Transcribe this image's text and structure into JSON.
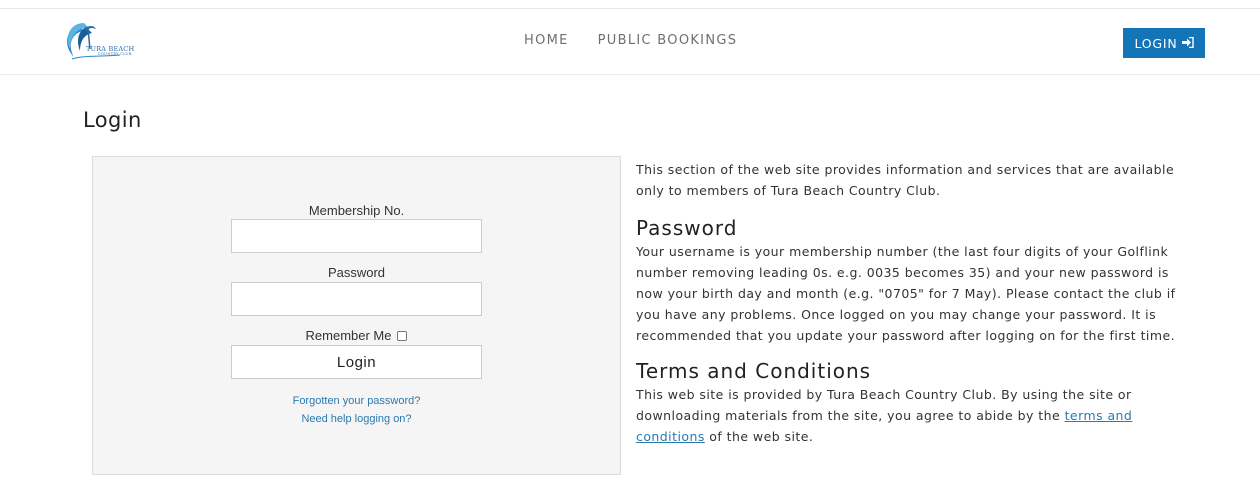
{
  "brand": {
    "logo_text": "TURA BEACH",
    "logo_subtext": "COUNTRY CLUB",
    "colors": {
      "primary": "#1474b8",
      "link": "#2a7ab0",
      "panel_bg": "#f5f5f5"
    }
  },
  "nav": {
    "items": [
      {
        "label": "HOME"
      },
      {
        "label": "PUBLIC BOOKINGS"
      }
    ],
    "login_label": "LOGIN",
    "login_icon": "sign-in-icon"
  },
  "page": {
    "title": "Login"
  },
  "form": {
    "membership_label": "Membership No.",
    "membership_value": "",
    "password_label": "Password",
    "password_value": "",
    "remember_label": "Remember Me",
    "remember_checked": false,
    "submit_label": "Login",
    "forgot_link": "Forgotten your password?",
    "help_link": "Need help logging on?"
  },
  "info": {
    "intro": "This section of the web site provides information and services that are available only to members of Tura Beach Country Club.",
    "password_heading": "Password",
    "password_text": "Your username is your membership number (the last four digits of your Golflink number removing leading 0s. e.g. 0035 becomes 35) and your new password is now your birth day and month (e.g. \"0705\" for 7 May). Please contact the club if you have any problems. Once logged on you may change your password. It is recommended that you update your password after logging on for the first time.",
    "terms_heading": "Terms and Conditions",
    "terms_text_before": "This web site is provided by Tura Beach Country Club. By using the site or downloading materials from the site, you agree to abide by the ",
    "terms_link": "terms and conditions",
    "terms_text_after": " of the web site."
  }
}
